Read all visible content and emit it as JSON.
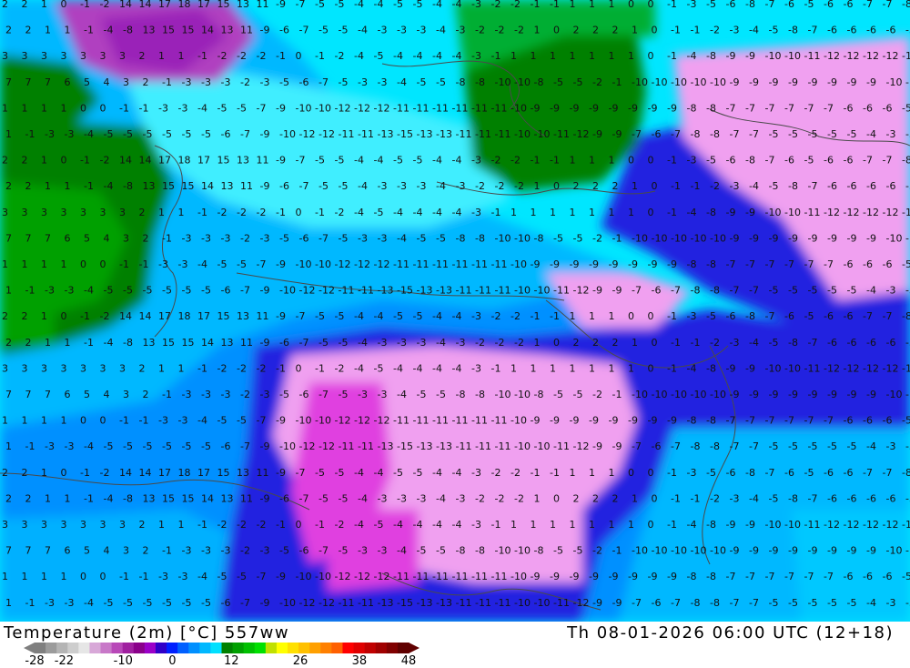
{
  "title": "Temperature (2m) [°C] 557ww",
  "datetime": "Th 08-01-2026 06:00 UTC (12+18)",
  "colorbar": {
    "colors": [
      "#7f7f7f",
      "#9b9b9b",
      "#b4b4b4",
      "#cdcdcd",
      "#e6e6e6",
      "#d8a8d8",
      "#c878c8",
      "#b848b8",
      "#a020a0",
      "#8a008a",
      "#9a00c8",
      "#3000c8",
      "#0020ff",
      "#0060ff",
      "#0090ff",
      "#00b8ff",
      "#00e0ff",
      "#008000",
      "#00a000",
      "#00c000",
      "#00e000",
      "#c0e000",
      "#ffff00",
      "#ffe000",
      "#ffc000",
      "#ffa000",
      "#ff8000",
      "#ff6000",
      "#ff0000",
      "#e00000",
      "#c00000",
      "#a00000",
      "#800000",
      "#600000"
    ],
    "ticks": [
      "-28",
      "-22",
      "-10",
      "0",
      "12",
      "26",
      "38",
      "48"
    ]
  },
  "map": {
    "grid_values_sample": [
      [
        "2",
        "2",
        "1",
        "0",
        "-1",
        "-2",
        "14",
        "14",
        "17",
        "18",
        "17",
        "15",
        "13",
        "11",
        "-9",
        "-7",
        "-5",
        "-5",
        "-4",
        "-4",
        "-5",
        "-5",
        "-4",
        "-4",
        "-3",
        "-2",
        "-2",
        "-1",
        "-1",
        "1",
        "1",
        "1",
        "0",
        "0",
        "-1",
        "-3",
        "-5",
        "-6",
        "-8",
        "-7",
        "-6",
        "-5",
        "-6",
        "-6",
        "-7",
        "-7",
        "-8"
      ],
      [
        "2",
        "2",
        "1",
        "1",
        "-1",
        "-4",
        "-8",
        "13",
        "15",
        "15",
        "14",
        "13",
        "11",
        "-9",
        "-6",
        "-7",
        "-5",
        "-5",
        "-4",
        "-3",
        "-3",
        "-3",
        "-4",
        "-3",
        "-2",
        "-2",
        "-2",
        "1",
        "0",
        "2",
        "2",
        "2",
        "1",
        "0",
        "-1",
        "-1",
        "-2",
        "-3",
        "-4",
        "-5",
        "-8",
        "-7",
        "-6",
        "-6",
        "-6",
        "-6",
        "-5"
      ],
      [
        "3",
        "3",
        "3",
        "3",
        "3",
        "3",
        "3",
        "2",
        "1",
        "1",
        "-1",
        "-2",
        "-2",
        "-2",
        "-1",
        "0",
        "-1",
        "-2",
        "-4",
        "-5",
        "-4",
        "-4",
        "-4",
        "-4",
        "-3",
        "-1",
        "1",
        "1",
        "1",
        "1",
        "1",
        "1",
        "1",
        "0",
        "-1",
        "-4",
        "-8",
        "-9",
        "-9",
        "-10",
        "-10",
        "-11",
        "-12",
        "-12",
        "-12",
        "-12",
        "-12"
      ],
      [
        "7",
        "7",
        "7",
        "6",
        "5",
        "4",
        "3",
        "2",
        "-1",
        "-3",
        "-3",
        "-3",
        "-2",
        "-3",
        "-5",
        "-6",
        "-7",
        "-5",
        "-3",
        "-3",
        "-4",
        "-5",
        "-5",
        "-8",
        "-8",
        "-10",
        "-10",
        "-8",
        "-5",
        "-5",
        "-2",
        "-1",
        "-10",
        "-10",
        "-10",
        "-10",
        "-10",
        "-9",
        "-9",
        "-9",
        "-9",
        "-9",
        "-9",
        "-9",
        "-9",
        "-10",
        "-10"
      ],
      [
        "1",
        "1",
        "1",
        "1",
        "0",
        "0",
        "-1",
        "-1",
        "-3",
        "-3",
        "-4",
        "-5",
        "-5",
        "-7",
        "-9",
        "-10",
        "-10",
        "-12",
        "-12",
        "-12",
        "-11",
        "-11",
        "-11",
        "-11",
        "-11",
        "-11",
        "-10",
        "-9",
        "-9",
        "-9",
        "-9",
        "-9",
        "-9",
        "-9",
        "-9",
        "-8",
        "-8",
        "-7",
        "-7",
        "-7",
        "-7",
        "-7",
        "-7",
        "-6",
        "-6",
        "-6",
        "-5"
      ],
      [
        "1",
        "-1",
        "-3",
        "-3",
        "-4",
        "-5",
        "-5",
        "-5",
        "-5",
        "-5",
        "-5",
        "-6",
        "-7",
        "-9",
        "-10",
        "-12",
        "-12",
        "-11",
        "-11",
        "-13",
        "-15",
        "-13",
        "-13",
        "-11",
        "-11",
        "-11",
        "-10",
        "-10",
        "-11",
        "-12",
        "-9",
        "-9",
        "-7",
        "-6",
        "-7",
        "-8",
        "-8",
        "-7",
        "-7",
        "-5",
        "-5",
        "-5",
        "-5",
        "-5",
        "-4",
        "-3",
        "-3"
      ]
    ]
  }
}
